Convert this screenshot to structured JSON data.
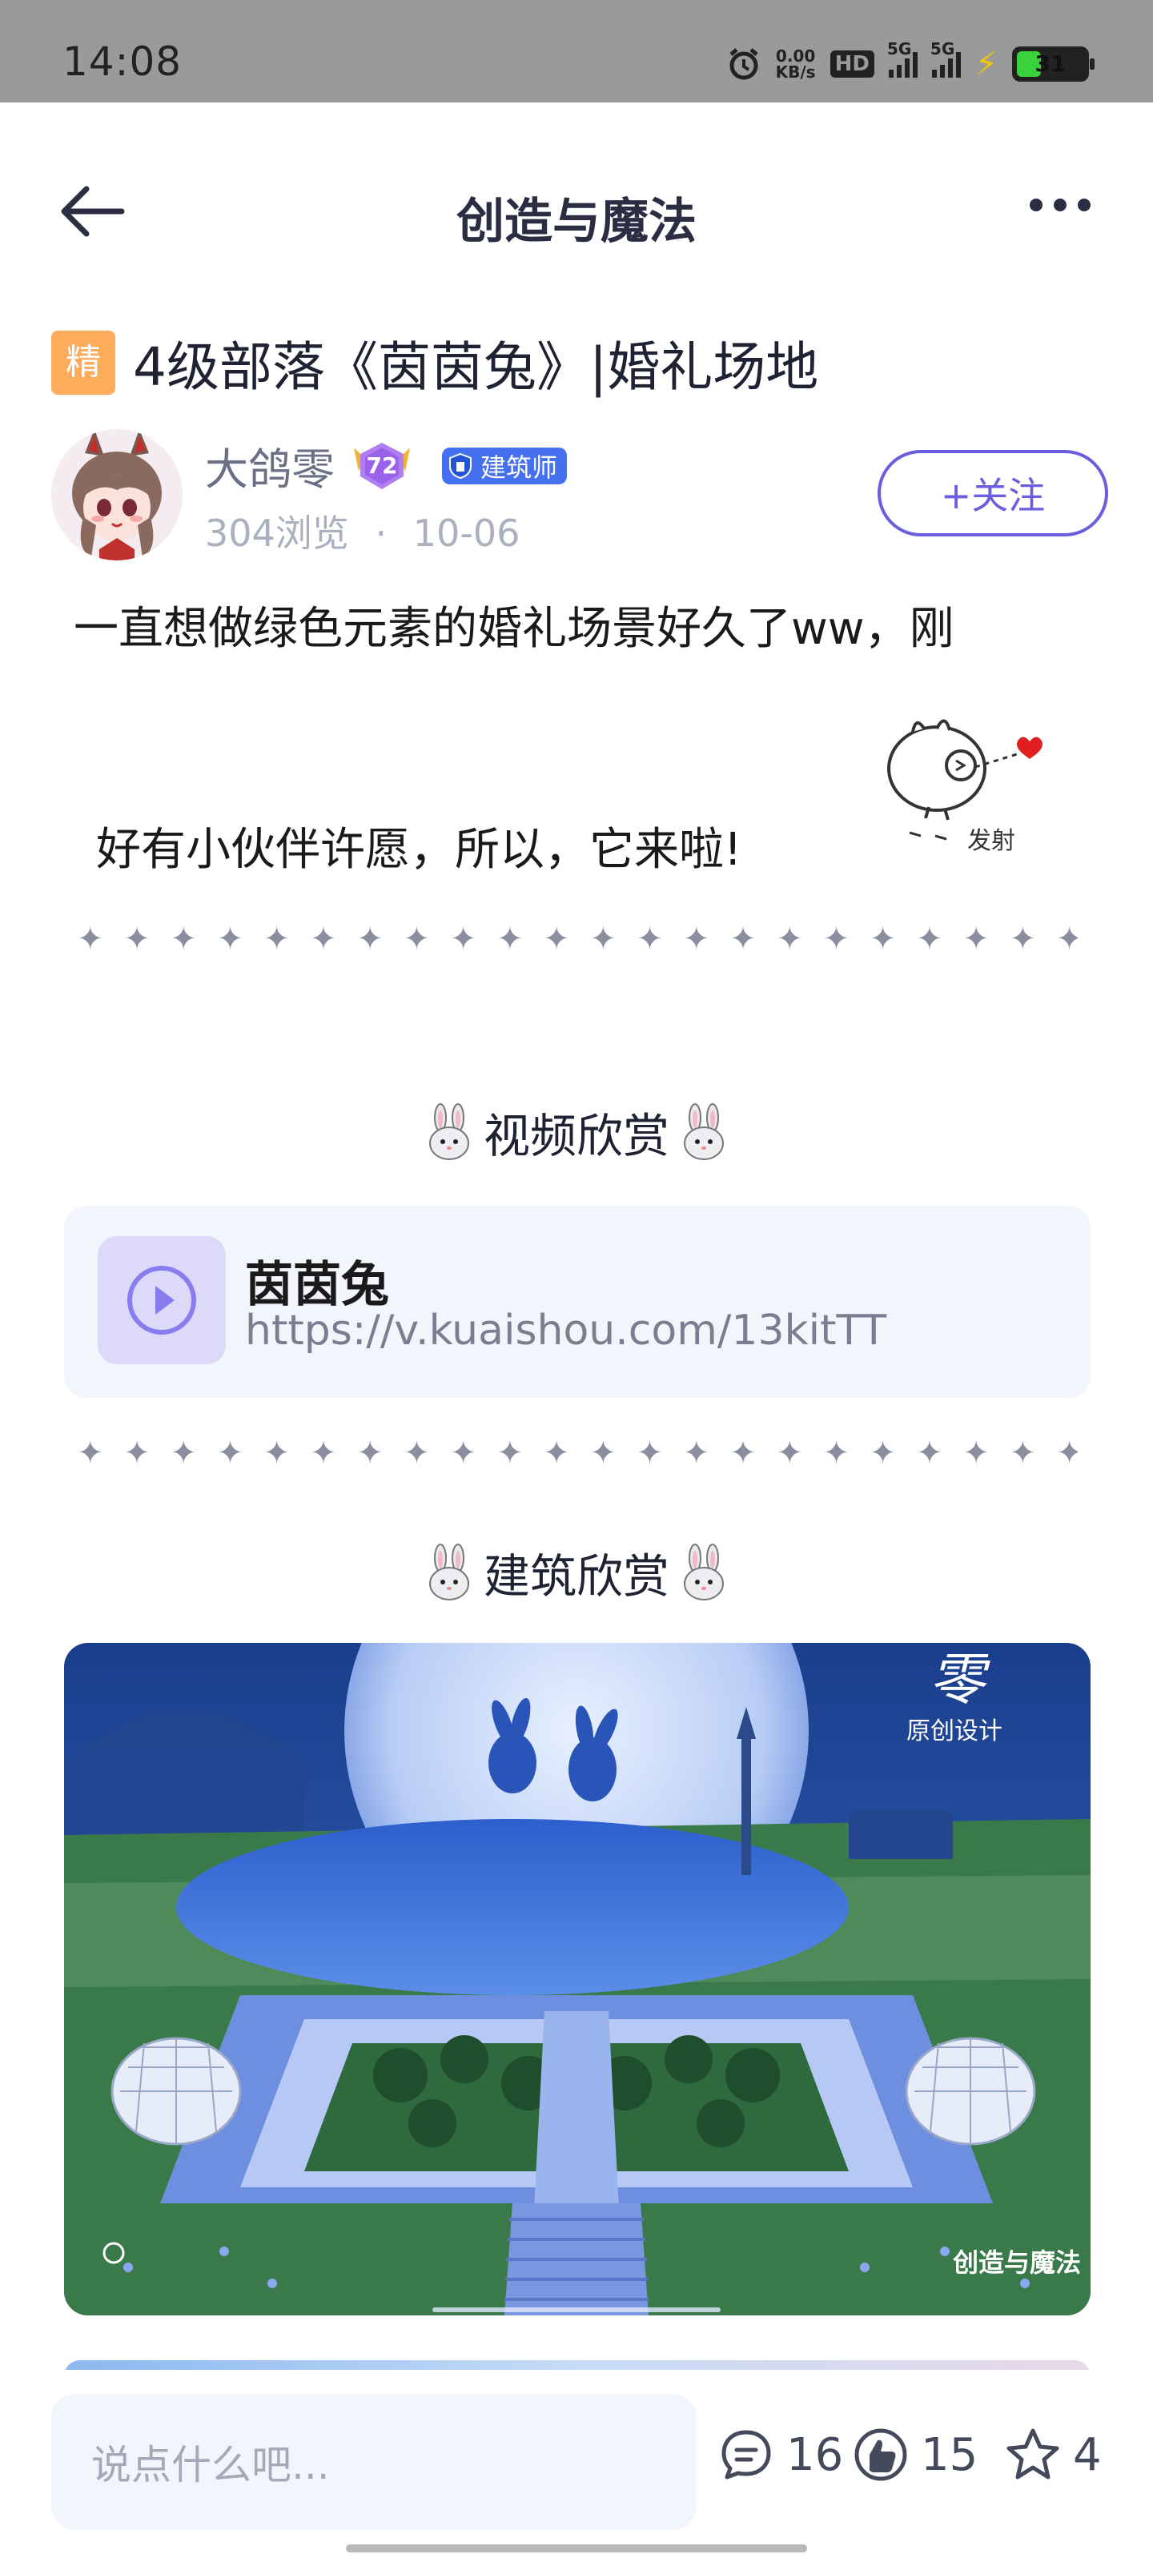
{
  "status_bar": {
    "time": "14:08",
    "net_speed_top": "0.00",
    "net_speed_bottom": "KB/s",
    "hd_label": "HD",
    "sim1_label": "5G",
    "sim2_label": "5G",
    "battery_level": "31",
    "battery_fraction": 0.31
  },
  "header": {
    "title": "创造与魔法"
  },
  "post": {
    "badge": "精",
    "title": "4级部落《茵茵兔》|婚礼场地",
    "author": {
      "name": "大鸽零",
      "level": "72",
      "role": "建筑师",
      "views": "304浏览",
      "separator": "·",
      "date": "10-06",
      "follow_label": "+关注"
    },
    "body_line1": "一直想做绿色元素的婚礼场景好久了ww，刚",
    "body_line2": "好有小伙伴许愿，所以，它来啦!",
    "sticker_text": "发射",
    "divider": "✦ ✦ ✦ ✦ ✦ ✦ ✦ ✦ ✦ ✦ ✦ ✦ ✦ ✦ ✦ ✦ ✦ ✦ ✦ ✦ ✦ ✦ ✦ ✦",
    "sections": [
      {
        "heading": "视频欣赏"
      },
      {
        "heading": "建筑欣赏"
      }
    ],
    "video": {
      "title": "茵茵兔",
      "url": "https://v.kuaishou.com/13kitTT"
    },
    "image_watermark": {
      "top_right": "零",
      "top_right_sub": "原创设计",
      "bottom_right": "创造与魔法"
    }
  },
  "bottom_bar": {
    "comment_placeholder": "说点什么吧...",
    "comments": "16",
    "likes": "15",
    "favorites": "4"
  },
  "colors": {
    "accent": "#6a5de0",
    "badge_orange": "#ffad5c",
    "role_blue": "#4570f0",
    "card_bg": "#f3f5fc",
    "status_bar_bg": "#9a9a9a"
  }
}
